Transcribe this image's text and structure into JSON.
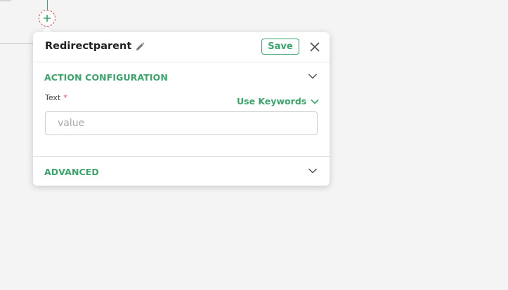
{
  "panel": {
    "title": "Redirectparent",
    "save_label": "Save"
  },
  "sections": {
    "action_configuration": {
      "title": "ACTION CONFIGURATION",
      "field_label": "Text",
      "required_mark": "*",
      "keywords_label": "Use Keywords",
      "input_value": "",
      "input_placeholder": "value"
    },
    "advanced": {
      "title": "ADVANCED"
    }
  },
  "icons": {
    "add": "plus-icon",
    "edit": "pencil-icon",
    "close": "close-icon",
    "expand": "chevron-down-icon"
  },
  "colors": {
    "accent": "#3aa46a",
    "required": "#e04a4a",
    "background": "#f4f4f4"
  }
}
